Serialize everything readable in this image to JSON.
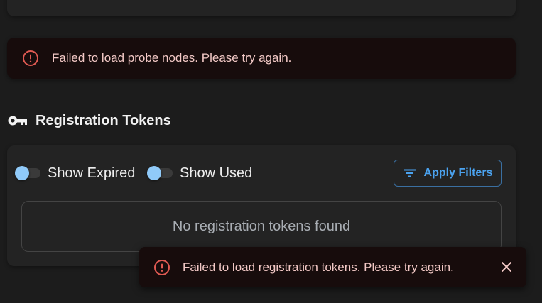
{
  "probe_nodes_alert": {
    "icon": "error-outline-icon",
    "message": "Failed to load probe nodes. Please try again."
  },
  "registration_tokens": {
    "icon": "key-icon",
    "title": "Registration Tokens",
    "filters": {
      "show_expired": {
        "label": "Show Expired",
        "checked": false
      },
      "show_used": {
        "label": "Show Used",
        "checked": false
      },
      "apply_button": {
        "label": "Apply Filters",
        "icon": "filter-list-icon"
      }
    },
    "empty_message": "No registration tokens found"
  },
  "toast": {
    "icon": "error-outline-icon",
    "message": "Failed to load registration tokens. Please try again.",
    "close_icon": "close-icon"
  },
  "colors": {
    "background": "#1c1c1c",
    "card": "#232323",
    "error_bg": "#170c0c",
    "error_icon": "#e05a52",
    "error_text": "#f3c9c6",
    "accent": "#4ba3f0",
    "switch_thumb": "#90caf9"
  }
}
